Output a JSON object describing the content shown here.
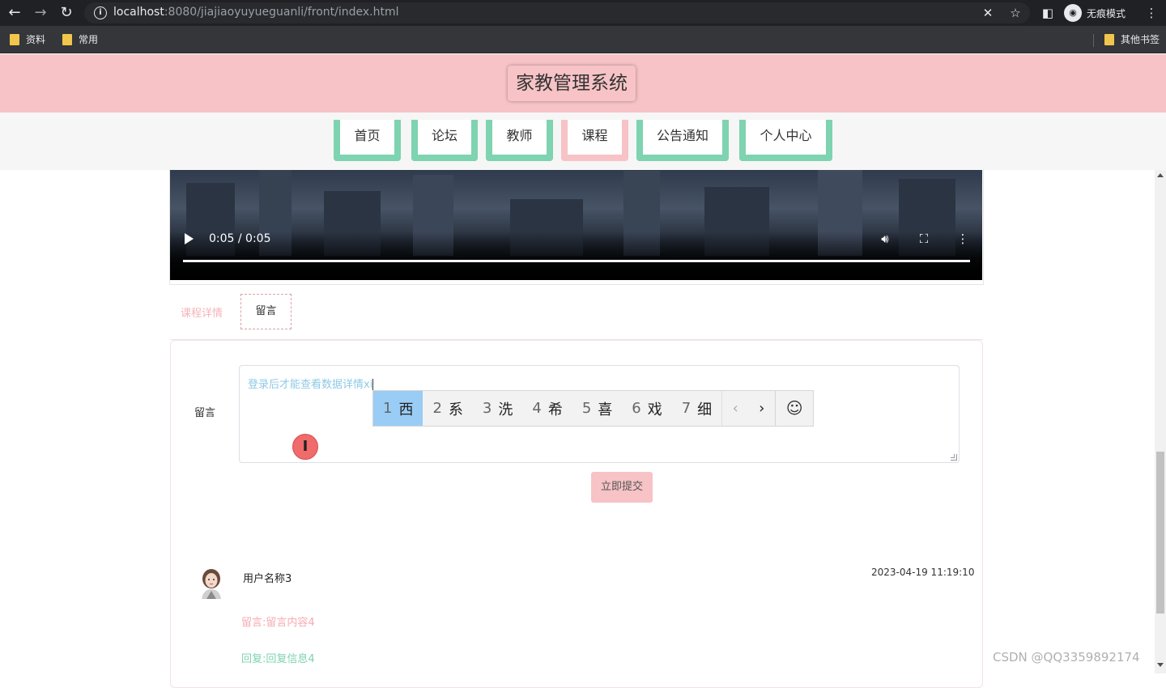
{
  "browser": {
    "url_host": "localhost",
    "url_rest": ":8080/jiajiaoyuyueguanli/front/index.html",
    "incognito_label": "无痕模式",
    "bookmarks": [
      "资料",
      "常用"
    ],
    "other_bookmarks": "其他书签"
  },
  "site": {
    "title": "家教管理系统",
    "nav": [
      "首页",
      "论坛",
      "教师",
      "课程",
      "公告通知",
      "个人中心"
    ],
    "active_nav": "课程",
    "accent_pink": "#f7c3c6",
    "accent_green": "#7ed3b0"
  },
  "video": {
    "time": "0:05 / 0:05"
  },
  "tabs": {
    "detail": "课程详情",
    "message": "留言"
  },
  "form": {
    "label": "留言",
    "input_value": "登录后才能查看数据详情xi",
    "submit": "立即提交"
  },
  "ime": {
    "candidates": [
      {
        "n": "1",
        "c": "西"
      },
      {
        "n": "2",
        "c": "系"
      },
      {
        "n": "3",
        "c": "洗"
      },
      {
        "n": "4",
        "c": "希"
      },
      {
        "n": "5",
        "c": "喜"
      },
      {
        "n": "6",
        "c": "戏"
      },
      {
        "n": "7",
        "c": "细"
      }
    ],
    "prev": "‹",
    "next": "›",
    "emoji": "☺"
  },
  "comment": {
    "user": "用户名称3",
    "time": "2023-04-19 11:19:10",
    "message": "留言:留言内容4",
    "reply": "回复:回复信息4"
  },
  "watermark": "CSDN @QQ3359892174"
}
